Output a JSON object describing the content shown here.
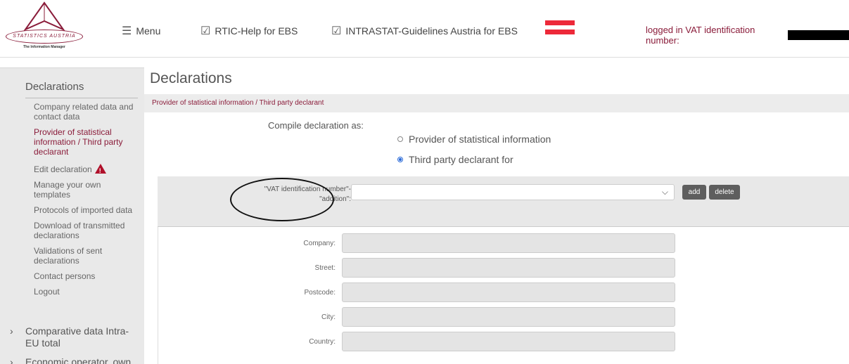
{
  "header": {
    "logo_text": "STATISTICS AUSTRIA",
    "logo_sub": "The Information Manager",
    "menu_label": "Menu",
    "nav_rtic": "RTIC-Help for EBS",
    "nav_intrastat": "INTRASTAT-Guidelines Austria for EBS",
    "login_label": "logged in VAT identification number:",
    "flag_colors": [
      "#ed2939",
      "#ffffff",
      "#ed2939"
    ]
  },
  "sidebar": {
    "heading": "Declarations",
    "items": [
      "Company related data and contact data",
      "Provider of statistical information / Third party declarant",
      "Edit declaration",
      "Manage your own templates",
      "Protocols of imported data",
      "Download of transmitted declarations",
      "Validations of sent declarations",
      "Contact persons",
      "Logout"
    ],
    "groups": [
      "Comparative data Intra-EU total",
      "Economic operator, own"
    ]
  },
  "main": {
    "title": "Declarations",
    "breadcrumb": "Provider of statistical information / Third party declarant",
    "compile_label": "Compile declaration as:",
    "radio_provider": "Provider of statistical information",
    "radio_third": "Third party declarant for",
    "vat_label_1": "\"VAT identification number\"-",
    "vat_label_2": "\"addition\":",
    "add_label": "add",
    "delete_label": "delete",
    "fields": [
      "Company:",
      "Street:",
      "Postcode:",
      "City:",
      "Country:"
    ]
  },
  "colors": {
    "accent": "#8a1c3a",
    "radio_selected": "#2a6ad8"
  }
}
